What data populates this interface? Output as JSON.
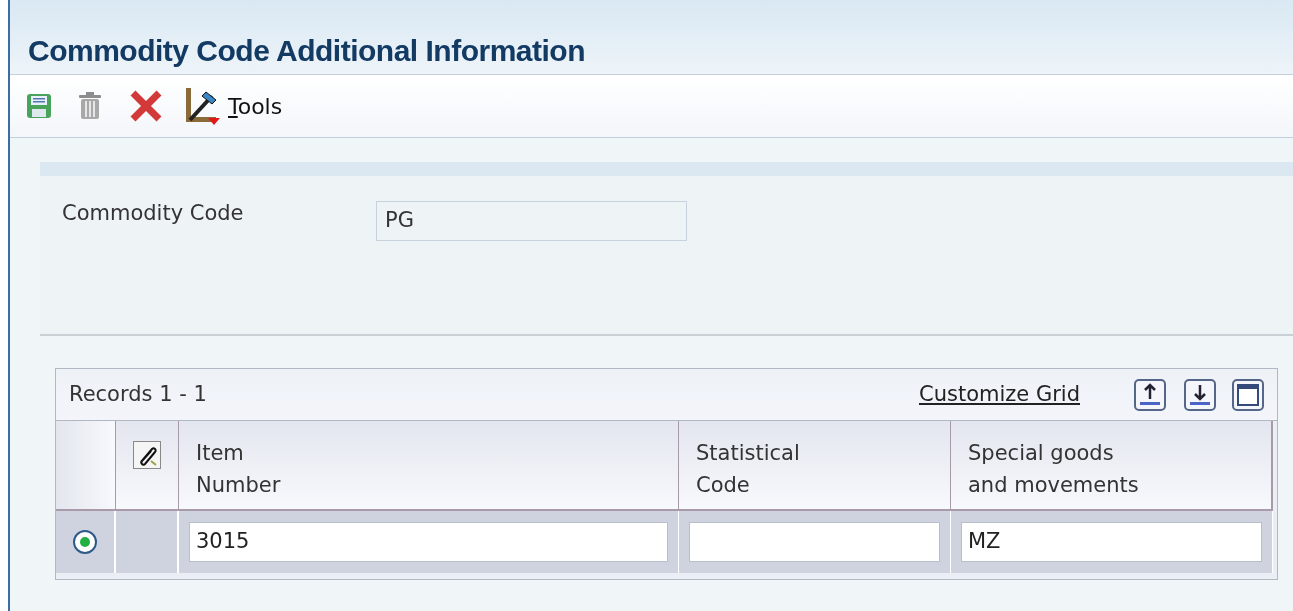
{
  "window": {
    "title": "Commodity Code Additional Information"
  },
  "toolbar": {
    "tools_label": "Tools"
  },
  "form": {
    "fields": [
      {
        "label": "Commodity Code",
        "value": "PG"
      }
    ]
  },
  "grid": {
    "records": "Records 1 - 1",
    "customize_link": "Customize Grid",
    "columns": [
      {
        "label": "Item\nNumber"
      },
      {
        "label": "Statistical\nCode"
      },
      {
        "label": "Special goods\nand movements"
      }
    ],
    "rows": [
      {
        "selected": true,
        "cells": [
          "3015",
          "",
          "MZ"
        ]
      }
    ]
  }
}
